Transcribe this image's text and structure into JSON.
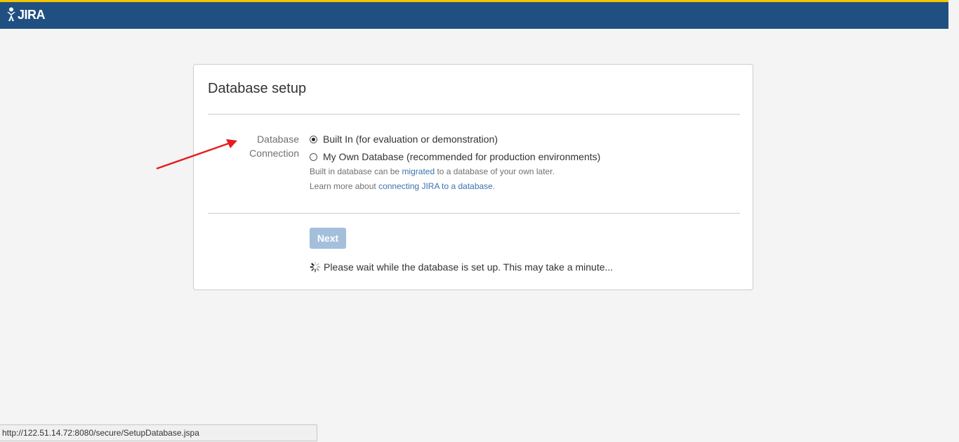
{
  "header": {
    "logo_text": "JIRA",
    "brand_color": "#205081",
    "accent_color": "#f5c400"
  },
  "panel": {
    "title": "Database setup",
    "field_label_line1": "Database",
    "field_label_line2": "Connection",
    "options": [
      {
        "label": "Built In (for evaluation or demonstration)",
        "checked": true
      },
      {
        "label": "My Own Database (recommended for production environments)",
        "checked": false
      }
    ],
    "hint1": {
      "before": "Built in database can be ",
      "link": "migrated",
      "after": " to a database of your own later."
    },
    "hint2": {
      "before": "Learn more about ",
      "link": "connecting JIRA to a database",
      "after": "."
    },
    "next_label": "Next",
    "wait_text": "Please wait while the database is set up. This may take a minute..."
  },
  "status_bar": {
    "url": "http://122.51.14.72:8080/secure/SetupDatabase.jspa"
  },
  "icons": {
    "logo": "jira-logo-icon",
    "spinner": "loading-spinner-icon",
    "annotation": "red-arrow-icon"
  }
}
